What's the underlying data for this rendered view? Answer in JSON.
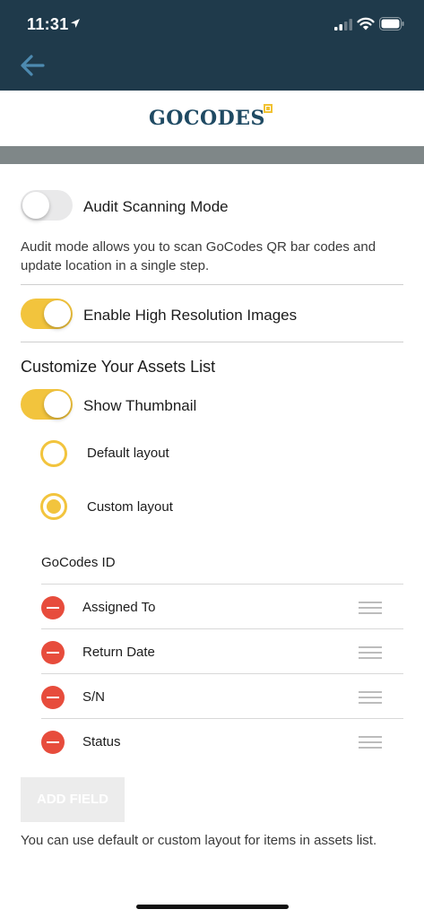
{
  "status_bar": {
    "time": "11:31"
  },
  "logo": {
    "text": "GOCODES"
  },
  "audit": {
    "label": "Audit  Scanning Mode",
    "enabled": false,
    "description": "Audit mode allows you to scan GoCodes QR bar codes and update location in a single step."
  },
  "high_res": {
    "label": "Enable High Resolution Images",
    "enabled": true
  },
  "customize": {
    "title": "Customize Your Assets List",
    "thumbnail": {
      "label": "Show Thumbnail",
      "enabled": true
    },
    "layouts": [
      {
        "label": "Default layout",
        "selected": false
      },
      {
        "label": "Custom layout",
        "selected": true
      }
    ],
    "fixed_field": "GoCodes ID",
    "fields": [
      {
        "label": "Assigned To"
      },
      {
        "label": "Return Date"
      },
      {
        "label": "S/N"
      },
      {
        "label": "Status"
      }
    ],
    "add_button": "ADD FIELD",
    "footnote": "You can use default or custom layout for items in assets list."
  },
  "colors": {
    "header": "#1f3a4b",
    "accent": "#f2c43d",
    "remove": "#e74c3c",
    "back_arrow": "#4d8ab0"
  }
}
